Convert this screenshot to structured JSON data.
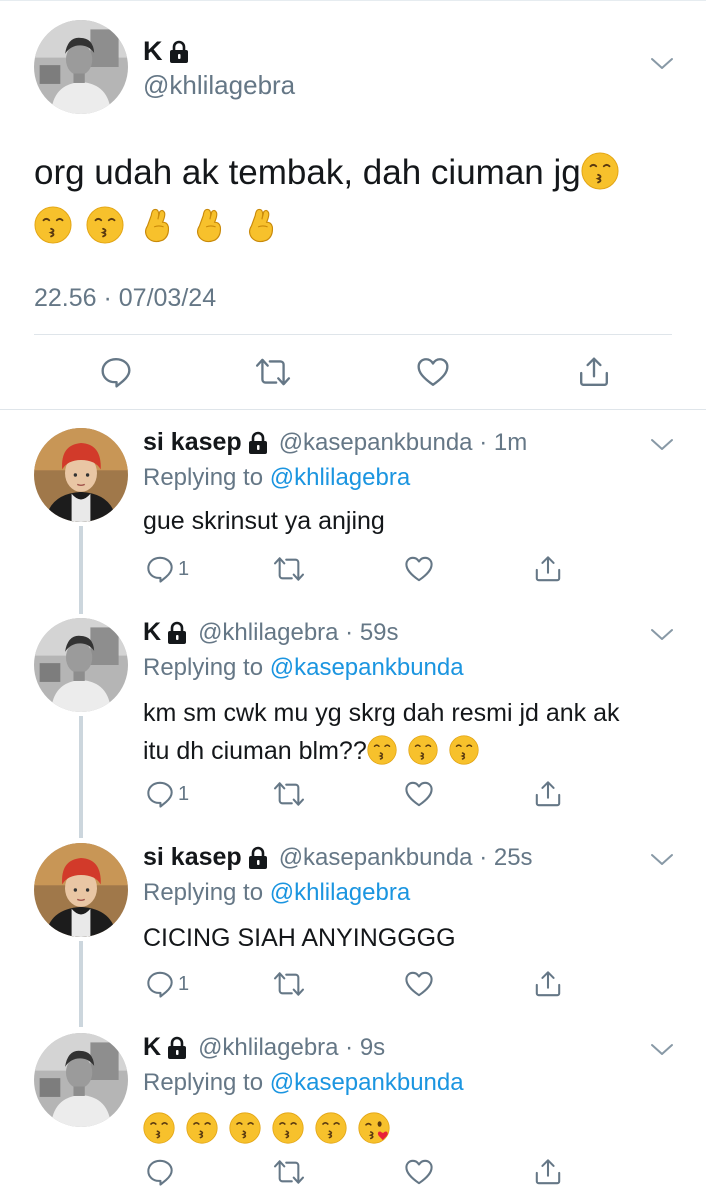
{
  "main_tweet": {
    "name": "K",
    "handle": "@khlilagebra",
    "text": "org udah ak tembak, dah ciuman jg",
    "time": "22.56 · 07/03/24"
  },
  "replies": [
    {
      "name": "si kasep",
      "handle_time": "@kasepankbunda · 1m",
      "replying_prefix": "Replying to",
      "replying_to": "@khlilagebra",
      "text": "gue skrinsut ya anjing",
      "reply_count": "1"
    },
    {
      "name": "K",
      "handle_time": "@khlilagebra · 59s",
      "replying_prefix": "Replying to",
      "replying_to": "@kasepankbunda",
      "text_line1": "km sm cwk mu yg skrg dah resmi jd ank ak",
      "text_line2": "itu dh ciuman blm??",
      "reply_count": "1"
    },
    {
      "name": "si kasep",
      "handle_time": "@kasepankbunda · 25s",
      "replying_prefix": "Replying to",
      "replying_to": "@khlilagebra",
      "text": "CICING SIAH ANYINGGGG",
      "reply_count": "1"
    },
    {
      "name": "K",
      "handle_time": "@khlilagebra · 9s",
      "replying_prefix": "Replying to",
      "replying_to": "@kasepankbunda"
    }
  ],
  "icons": {
    "action_color": "#657786",
    "link_color": "#1b95e0",
    "emoji_face": "#f7c12c"
  }
}
